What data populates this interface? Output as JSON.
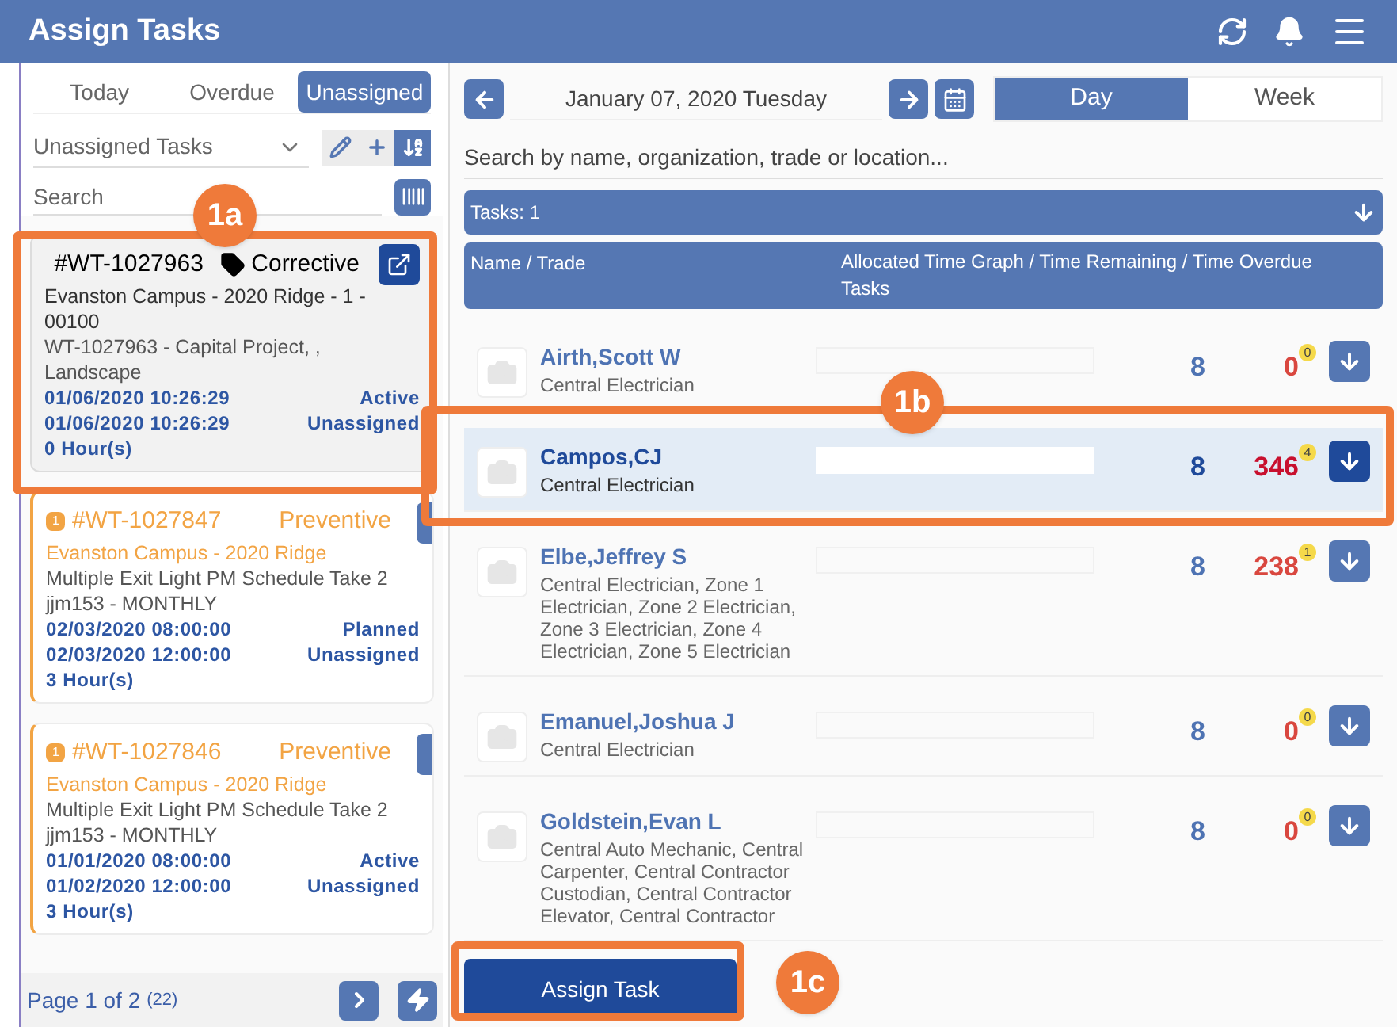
{
  "header": {
    "title": "Assign Tasks"
  },
  "filter_tabs": [
    {
      "label": "Today",
      "selected": false
    },
    {
      "label": "Overdue",
      "selected": false
    },
    {
      "label": "Unassigned",
      "selected": true
    }
  ],
  "list_selector": {
    "value": "Unassigned Tasks"
  },
  "tools": [
    {
      "kind": "edit",
      "selected": false
    },
    {
      "kind": "add",
      "selected": false
    },
    {
      "kind": "sort",
      "selected": true
    }
  ],
  "search": {
    "placeholder": "Search"
  },
  "tasks": [
    {
      "kind": "corrective",
      "selected": true,
      "number": "#WT-1027963",
      "type": "Corrective",
      "location": "Evanston Campus - 2020 Ridge - 1 - 00100",
      "description": "WT-1027963 - Capital Project, , Landscape",
      "start": "01/06/2020 10:26:29",
      "status": "Active",
      "end": "01/06/2020 10:26:29",
      "assignment": "Unassigned",
      "duration": "0 Hour(s)"
    },
    {
      "kind": "preventive",
      "selected": false,
      "priority": "1",
      "number": "#WT-1027847",
      "type": "Preventive",
      "location": "Evanston Campus - 2020 Ridge",
      "description": "Multiple Exit Light PM Schedule Take 2 jjm153 - MONTHLY",
      "start": "02/03/2020 08:00:00",
      "status": "Planned",
      "end": "02/03/2020 12:00:00",
      "assignment": "Unassigned",
      "duration": "3 Hour(s)"
    },
    {
      "kind": "preventive",
      "selected": false,
      "priority": "1",
      "number": "#WT-1027846",
      "type": "Preventive",
      "location": "Evanston Campus - 2020 Ridge",
      "description": "Multiple Exit Light PM Schedule Take 2 jjm153 - MONTHLY",
      "start": "01/01/2020 08:00:00",
      "status": "Active",
      "end": "01/02/2020 12:00:00",
      "assignment": "Unassigned",
      "duration": "3 Hour(s)"
    }
  ],
  "pager": {
    "page": "Page 1 of 2",
    "count": "(22)"
  },
  "date_nav": {
    "date": "January 07, 2020 Tuesday"
  },
  "view_tabs": [
    {
      "label": "Day",
      "selected": true
    },
    {
      "label": "Week",
      "selected": false
    }
  ],
  "worker_search": {
    "placeholder": "Search by name, organization, trade or location..."
  },
  "tasks_bar": {
    "label": "Tasks: 1"
  },
  "columns": [
    "Name / Trade",
    "Allocated Time Graph / Time Remaining / Time Overdue Tasks"
  ],
  "workers": [
    {
      "name": "Airth,Scott W",
      "trade": "Central Electrician",
      "remaining": "8",
      "overdue": "0",
      "overdue_count": "0",
      "selected": false
    },
    {
      "name": "Campos,CJ",
      "trade": "Central Electrician",
      "remaining": "8",
      "overdue": "346",
      "overdue_count": "4",
      "selected": true
    },
    {
      "name": "Elbe,Jeffrey S",
      "trade": "Central Electrician, Zone 1 Electrician, Zone 2 Electrician, Zone 3 Electrician, Zone 4 Electrician, Zone 5 Electrician",
      "remaining": "8",
      "overdue": "238",
      "overdue_count": "1",
      "selected": false
    },
    {
      "name": "Emanuel,Joshua J",
      "trade": "Central Electrician",
      "remaining": "8",
      "overdue": "0",
      "overdue_count": "0",
      "selected": false
    },
    {
      "name": "Goldstein,Evan L",
      "trade": "Central Auto Mechanic, Central Carpenter, Central Contractor Custodian, Central Contractor Elevator, Central Contractor",
      "remaining": "8",
      "overdue": "0",
      "overdue_count": "0",
      "selected": false
    }
  ],
  "assign_button": {
    "label": "Assign Task"
  },
  "callouts": [
    {
      "label": "1a",
      "kind": "card"
    },
    {
      "label": "1b",
      "kind": "row"
    },
    {
      "label": "1c",
      "kind": "button"
    }
  ]
}
